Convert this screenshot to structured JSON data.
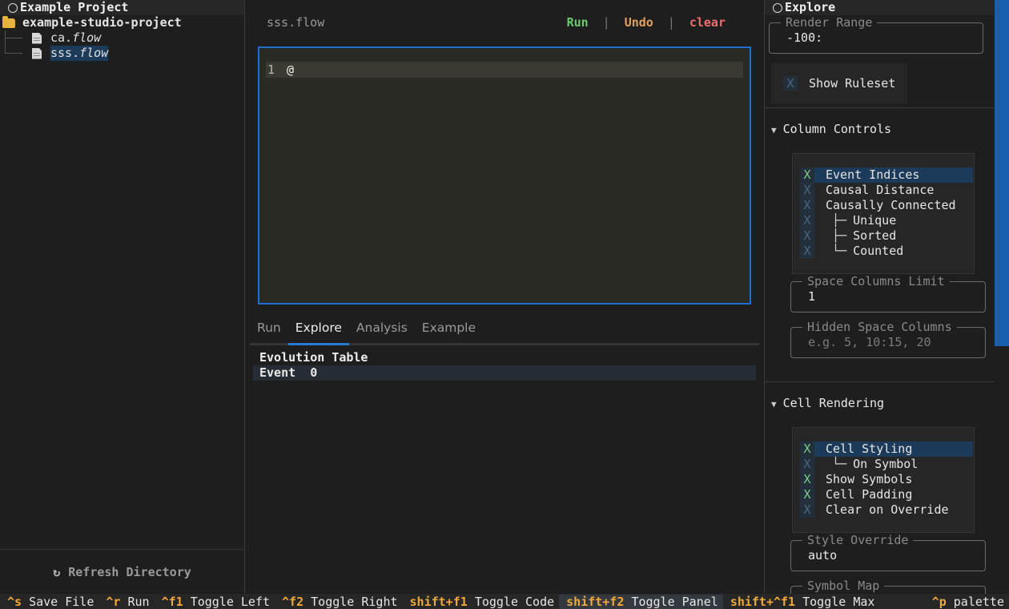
{
  "left_panel": {
    "title": "Example Project",
    "folder": "example-studio-project",
    "files": [
      {
        "base": "ca.",
        "ext": "flow"
      },
      {
        "base": "sss.",
        "ext": "flow"
      }
    ],
    "refresh_label": "Refresh Directory",
    "refresh_icon": "↻"
  },
  "editor": {
    "filename": "sss.flow",
    "actions": {
      "run": "Run",
      "undo": "Undo",
      "clear": "clear",
      "separator": "|"
    },
    "lines": [
      {
        "num": "1",
        "code": "@"
      }
    ]
  },
  "output": {
    "tabs": [
      "Run",
      "Explore",
      "Analysis",
      "Example"
    ],
    "active_tab": "Explore",
    "table_title": "Evolution Table",
    "table_row": "Event  0"
  },
  "right_panel": {
    "title": "Explore",
    "render_range": {
      "label": "Render Range",
      "value": "-100:"
    },
    "show_ruleset": {
      "label": "Show Ruleset",
      "mark": "X"
    },
    "column_controls": {
      "title": "Column Controls",
      "items": [
        {
          "label": "Event Indices",
          "mark": "X",
          "checked": true
        },
        {
          "label": "Causal Distance",
          "mark": "X",
          "checked": false
        },
        {
          "label": "Causally Connected",
          "mark": "X",
          "checked": false
        },
        {
          "label": "Unique",
          "mark": "X",
          "checked": false,
          "guide": "├─"
        },
        {
          "label": "Sorted",
          "mark": "X",
          "checked": false,
          "guide": "├─"
        },
        {
          "label": "Counted",
          "mark": "X",
          "checked": false,
          "guide": "└─"
        }
      ],
      "space_columns_limit": {
        "label": "Space Columns Limit",
        "value": "1"
      },
      "hidden_space_columns": {
        "label": "Hidden Space Columns",
        "placeholder": "e.g. 5, 10:15, 20"
      }
    },
    "cell_rendering": {
      "title": "Cell Rendering",
      "items": [
        {
          "label": "Cell Styling",
          "mark": "X",
          "checked": true
        },
        {
          "label": "On Symbol",
          "mark": "X",
          "checked": false,
          "guide": "└─"
        },
        {
          "label": "Show Symbols",
          "mark": "X",
          "checked": true
        },
        {
          "label": "Cell Padding",
          "mark": "X",
          "checked": true
        },
        {
          "label": "Clear on Override",
          "mark": "X",
          "checked": false
        }
      ],
      "style_override": {
        "label": "Style Override",
        "value": "auto"
      },
      "symbol_map": {
        "label": "Symbol Map"
      }
    }
  },
  "footer": {
    "bindings": [
      {
        "key": "^s",
        "label": "Save File"
      },
      {
        "key": "^r",
        "label": "Run"
      },
      {
        "key": "^f1",
        "label": "Toggle Left"
      },
      {
        "key": "^f2",
        "label": "Toggle Right"
      },
      {
        "key": "shift+f1",
        "label": "Toggle Code"
      },
      {
        "key": "shift+f2",
        "label": "Toggle Panel"
      },
      {
        "key": "shift+^f1",
        "label": "Toggle Max"
      }
    ],
    "palette": {
      "key": "^p",
      "label": "palette"
    }
  },
  "colors": {
    "accent": "#1e6fd0",
    "run": "#6cc96c",
    "undo": "#e0a060",
    "clear": "#f06c6c",
    "footer_key": "#f0a83c"
  }
}
